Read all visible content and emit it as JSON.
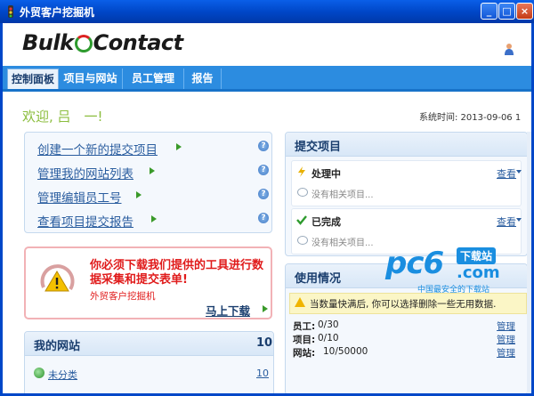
{
  "window": {
    "title": "外贸客户挖掘机",
    "min_label": "_",
    "max_label": "□",
    "close_label": "×"
  },
  "header": {
    "logo_left": "Bulk",
    "logo_right": "Contact"
  },
  "nav": {
    "tabs": [
      {
        "label": "控制面板",
        "active": true
      },
      {
        "label": "项目与网站",
        "active": false
      },
      {
        "label": "员工管理",
        "active": false
      },
      {
        "label": "报告",
        "active": false
      }
    ]
  },
  "welcome": {
    "text": "欢迎, 吕　一!",
    "system_time": "系统时间: 2013-09-06 1"
  },
  "quick_links": [
    {
      "label": "创建一个新的提交项目"
    },
    {
      "label": "管理我的网站列表"
    },
    {
      "label": "管理编辑员工号"
    },
    {
      "label": "查看项目提交报告"
    }
  ],
  "warning": {
    "title": "你必须下载我们提供的工具进行数据采集和提交表单!",
    "subtitle": "外贸客户挖掘机",
    "download": "马上下载"
  },
  "my_sites": {
    "title": "我的网站",
    "count": "10",
    "category": "未分类",
    "category_count": "10"
  },
  "submit_items": {
    "title": "提交项目",
    "rows": [
      {
        "status": "处理中",
        "view": "查看",
        "empty": "没有相关项目..."
      },
      {
        "status": "已完成",
        "view": "查看",
        "empty": "没有相关项目..."
      }
    ]
  },
  "usage": {
    "title": "使用情况",
    "notice": "当数量快满后, 你可以选择删除一些无用数据.",
    "rows": [
      {
        "label": "员工:",
        "value": "0/30",
        "action": "管理"
      },
      {
        "label": "项目:",
        "value": "0/10",
        "action": "管理"
      },
      {
        "label": "网站:",
        "value": "10/50000",
        "action": "管理"
      }
    ]
  },
  "watermark": {
    "brand": "pc6",
    "tag": "下载站",
    "domain": ".com",
    "slogan": "中国最安全的下载站"
  },
  "colors": {
    "accent": "#2c8ce0",
    "welcome": "#8bbd3d",
    "warning": "#e01b1b",
    "link": "#2a5d9f"
  }
}
